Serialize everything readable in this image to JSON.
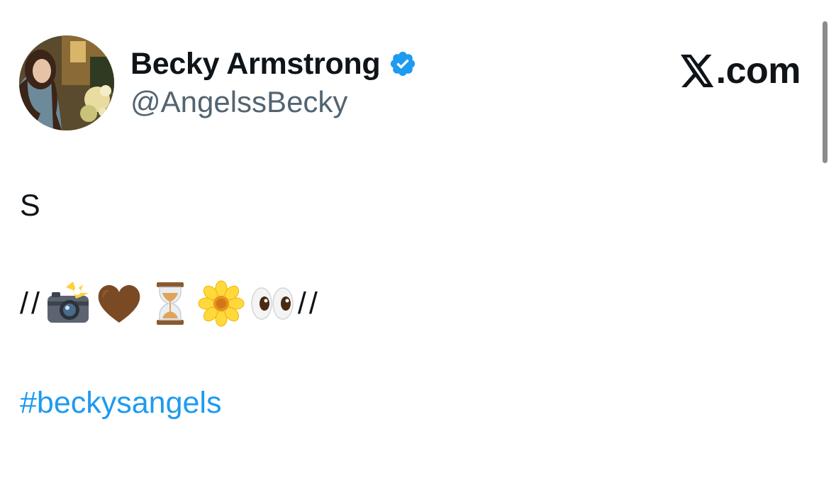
{
  "author": {
    "display_name": "Becky Armstrong",
    "handle": "@AngelssBecky",
    "verified": true,
    "avatar_icon": "profile-photo"
  },
  "brand": {
    "text": ".com",
    "logo_icon": "x-logo-icon"
  },
  "tweet": {
    "line1": "S",
    "line2_prefix": "//",
    "line2_suffix": "//",
    "emojis": [
      "camera-with-flash-icon",
      "brown-heart-icon",
      "hourglass-icon",
      "blossom-icon",
      "eyes-icon"
    ],
    "hashtag": "#beckysangels"
  },
  "colors": {
    "text": "#0f1419",
    "secondary_text": "#536471",
    "link": "#1d9bf0",
    "verified_badge": "#1d9bf0",
    "background": "#ffffff"
  }
}
